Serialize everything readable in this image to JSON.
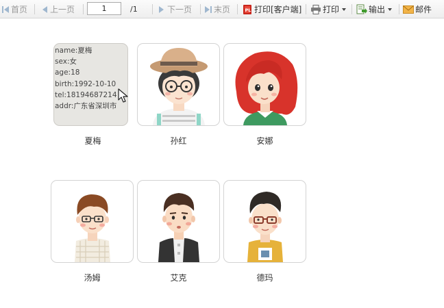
{
  "toolbar": {
    "first": "首页",
    "prev": "上一页",
    "page_value": "1",
    "page_total": "/1",
    "next": "下一页",
    "last": "末页",
    "print_client": "打印[客户端]",
    "print": "打印",
    "export": "输出",
    "mail": "邮件"
  },
  "people": [
    {
      "name": "夏梅",
      "details": [
        "name:夏梅",
        "sex:女",
        "age:18",
        "birth:1992-10-10",
        "tel:18194687214",
        "addr:广东省深圳市"
      ]
    },
    {
      "name": "孙红"
    },
    {
      "name": "安娜"
    },
    {
      "name": "汤姆"
    },
    {
      "name": "艾克"
    },
    {
      "name": "德玛"
    }
  ],
  "icons": {
    "first": "first-page-icon",
    "prev": "prev-page-icon",
    "next": "next-page-icon",
    "last": "last-page-icon",
    "print_client": "pdf-print-icon",
    "print": "printer-icon",
    "export": "export-icon",
    "mail": "mail-icon",
    "cursor": "mouse-pointer-icon"
  }
}
